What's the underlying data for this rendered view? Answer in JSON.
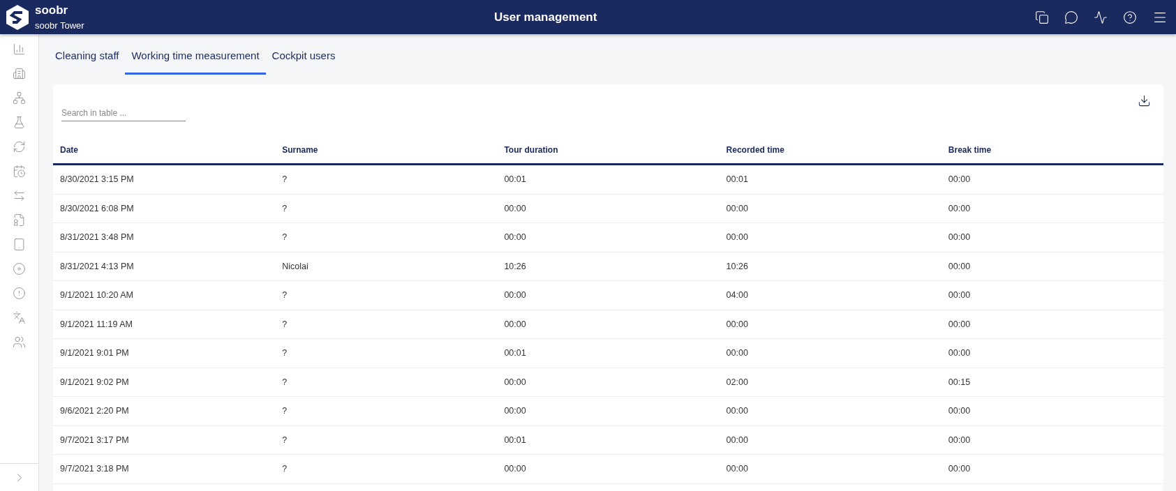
{
  "header": {
    "brand": "soobr",
    "building": "soobr Tower",
    "title": "User management"
  },
  "tabs": [
    {
      "label": "Cleaning staff",
      "selected": false
    },
    {
      "label": "Working time measurement",
      "selected": true
    },
    {
      "label": "Cockpit users",
      "selected": false
    }
  ],
  "search": {
    "placeholder": "Search in table ..."
  },
  "table": {
    "columns": [
      "Date",
      "Surname",
      "Tour duration",
      "Recorded time",
      "Break time"
    ],
    "rows": [
      [
        "8/30/2021 3:15 PM",
        "?",
        "00:01",
        "00:01",
        "00:00"
      ],
      [
        "8/30/2021 6:08 PM",
        "?",
        "00:00",
        "00:00",
        "00:00"
      ],
      [
        "8/31/2021 3:48 PM",
        "?",
        "00:00",
        "00:00",
        "00:00"
      ],
      [
        "8/31/2021 4:13 PM",
        "Nicolai",
        "10:26",
        "10:26",
        "00:00"
      ],
      [
        "9/1/2021 10:20 AM",
        "?",
        "00:00",
        "04:00",
        "00:00"
      ],
      [
        "9/1/2021 11:19 AM",
        "?",
        "00:00",
        "00:00",
        "00:00"
      ],
      [
        "9/1/2021 9:01 PM",
        "?",
        "00:01",
        "00:00",
        "00:00"
      ],
      [
        "9/1/2021 9:02 PM",
        "?",
        "00:00",
        "02:00",
        "00:15"
      ],
      [
        "9/6/2021 2:20 PM",
        "?",
        "00:00",
        "00:00",
        "00:00"
      ],
      [
        "9/7/2021 3:17 PM",
        "?",
        "00:01",
        "00:00",
        "00:00"
      ],
      [
        "9/7/2021 3:18 PM",
        "?",
        "00:00",
        "00:00",
        "00:00"
      ]
    ]
  }
}
